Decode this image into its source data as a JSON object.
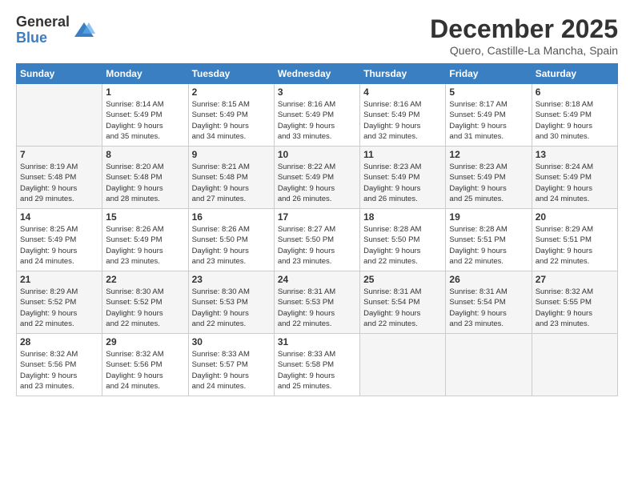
{
  "logo": {
    "general": "General",
    "blue": "Blue"
  },
  "title": "December 2025",
  "location": "Quero, Castille-La Mancha, Spain",
  "days_header": [
    "Sunday",
    "Monday",
    "Tuesday",
    "Wednesday",
    "Thursday",
    "Friday",
    "Saturday"
  ],
  "weeks": [
    [
      {
        "day": "",
        "info": ""
      },
      {
        "day": "1",
        "info": "Sunrise: 8:14 AM\nSunset: 5:49 PM\nDaylight: 9 hours\nand 35 minutes."
      },
      {
        "day": "2",
        "info": "Sunrise: 8:15 AM\nSunset: 5:49 PM\nDaylight: 9 hours\nand 34 minutes."
      },
      {
        "day": "3",
        "info": "Sunrise: 8:16 AM\nSunset: 5:49 PM\nDaylight: 9 hours\nand 33 minutes."
      },
      {
        "day": "4",
        "info": "Sunrise: 8:16 AM\nSunset: 5:49 PM\nDaylight: 9 hours\nand 32 minutes."
      },
      {
        "day": "5",
        "info": "Sunrise: 8:17 AM\nSunset: 5:49 PM\nDaylight: 9 hours\nand 31 minutes."
      },
      {
        "day": "6",
        "info": "Sunrise: 8:18 AM\nSunset: 5:49 PM\nDaylight: 9 hours\nand 30 minutes."
      }
    ],
    [
      {
        "day": "7",
        "info": "Sunrise: 8:19 AM\nSunset: 5:48 PM\nDaylight: 9 hours\nand 29 minutes."
      },
      {
        "day": "8",
        "info": "Sunrise: 8:20 AM\nSunset: 5:48 PM\nDaylight: 9 hours\nand 28 minutes."
      },
      {
        "day": "9",
        "info": "Sunrise: 8:21 AM\nSunset: 5:48 PM\nDaylight: 9 hours\nand 27 minutes."
      },
      {
        "day": "10",
        "info": "Sunrise: 8:22 AM\nSunset: 5:49 PM\nDaylight: 9 hours\nand 26 minutes."
      },
      {
        "day": "11",
        "info": "Sunrise: 8:23 AM\nSunset: 5:49 PM\nDaylight: 9 hours\nand 26 minutes."
      },
      {
        "day": "12",
        "info": "Sunrise: 8:23 AM\nSunset: 5:49 PM\nDaylight: 9 hours\nand 25 minutes."
      },
      {
        "day": "13",
        "info": "Sunrise: 8:24 AM\nSunset: 5:49 PM\nDaylight: 9 hours\nand 24 minutes."
      }
    ],
    [
      {
        "day": "14",
        "info": "Sunrise: 8:25 AM\nSunset: 5:49 PM\nDaylight: 9 hours\nand 24 minutes."
      },
      {
        "day": "15",
        "info": "Sunrise: 8:26 AM\nSunset: 5:49 PM\nDaylight: 9 hours\nand 23 minutes."
      },
      {
        "day": "16",
        "info": "Sunrise: 8:26 AM\nSunset: 5:50 PM\nDaylight: 9 hours\nand 23 minutes."
      },
      {
        "day": "17",
        "info": "Sunrise: 8:27 AM\nSunset: 5:50 PM\nDaylight: 9 hours\nand 23 minutes."
      },
      {
        "day": "18",
        "info": "Sunrise: 8:28 AM\nSunset: 5:50 PM\nDaylight: 9 hours\nand 22 minutes."
      },
      {
        "day": "19",
        "info": "Sunrise: 8:28 AM\nSunset: 5:51 PM\nDaylight: 9 hours\nand 22 minutes."
      },
      {
        "day": "20",
        "info": "Sunrise: 8:29 AM\nSunset: 5:51 PM\nDaylight: 9 hours\nand 22 minutes."
      }
    ],
    [
      {
        "day": "21",
        "info": "Sunrise: 8:29 AM\nSunset: 5:52 PM\nDaylight: 9 hours\nand 22 minutes."
      },
      {
        "day": "22",
        "info": "Sunrise: 8:30 AM\nSunset: 5:52 PM\nDaylight: 9 hours\nand 22 minutes."
      },
      {
        "day": "23",
        "info": "Sunrise: 8:30 AM\nSunset: 5:53 PM\nDaylight: 9 hours\nand 22 minutes."
      },
      {
        "day": "24",
        "info": "Sunrise: 8:31 AM\nSunset: 5:53 PM\nDaylight: 9 hours\nand 22 minutes."
      },
      {
        "day": "25",
        "info": "Sunrise: 8:31 AM\nSunset: 5:54 PM\nDaylight: 9 hours\nand 22 minutes."
      },
      {
        "day": "26",
        "info": "Sunrise: 8:31 AM\nSunset: 5:54 PM\nDaylight: 9 hours\nand 23 minutes."
      },
      {
        "day": "27",
        "info": "Sunrise: 8:32 AM\nSunset: 5:55 PM\nDaylight: 9 hours\nand 23 minutes."
      }
    ],
    [
      {
        "day": "28",
        "info": "Sunrise: 8:32 AM\nSunset: 5:56 PM\nDaylight: 9 hours\nand 23 minutes."
      },
      {
        "day": "29",
        "info": "Sunrise: 8:32 AM\nSunset: 5:56 PM\nDaylight: 9 hours\nand 24 minutes."
      },
      {
        "day": "30",
        "info": "Sunrise: 8:33 AM\nSunset: 5:57 PM\nDaylight: 9 hours\nand 24 minutes."
      },
      {
        "day": "31",
        "info": "Sunrise: 8:33 AM\nSunset: 5:58 PM\nDaylight: 9 hours\nand 25 minutes."
      },
      {
        "day": "",
        "info": ""
      },
      {
        "day": "",
        "info": ""
      },
      {
        "day": "",
        "info": ""
      }
    ]
  ]
}
